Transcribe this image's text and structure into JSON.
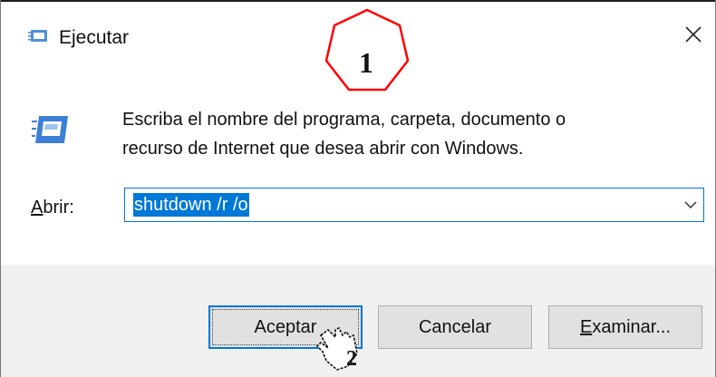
{
  "window": {
    "title": "Ejecutar",
    "description_line1": "Escriba el nombre del programa, carpeta, documento o",
    "description_line2": "recurso de Internet que desea abrir con Windows."
  },
  "open_field": {
    "label_mnemonic": "A",
    "label_rest": "brir:",
    "value": "shutdown /r /o"
  },
  "buttons": {
    "ok": "Aceptar",
    "cancel": "Cancelar",
    "browse_mnemonic": "E",
    "browse_rest": "xaminar..."
  },
  "annotations": {
    "step1": "1",
    "step2": "2"
  },
  "colors": {
    "accent": "#0078d7",
    "annotation": "#ff0000"
  },
  "icons": [
    "run-app-icon",
    "close-icon",
    "chevron-down-icon",
    "hand-pointer-icon"
  ]
}
